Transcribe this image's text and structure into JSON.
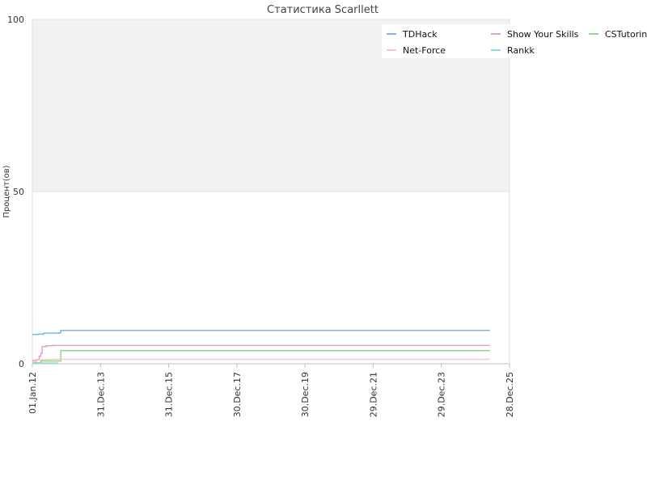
{
  "chart_data": {
    "type": "line",
    "title": "Статистика Scarllett",
    "subtitle": "",
    "xlabel": "",
    "ylabel": "Процент(ов)",
    "ylim": [
      0,
      100
    ],
    "xlim": [
      "2012-01-01",
      "2025-12-28"
    ],
    "x_tick_labels": [
      "01.Jan.12",
      "31.Dec.13",
      "31.Dec.15",
      "30.Dec.17",
      "30.Dec.19",
      "29.Dec.21",
      "29.Dec.23",
      "28.Dec.25"
    ],
    "y_tick_labels": [
      "0",
      "50",
      "100"
    ],
    "y_ticks": [
      0,
      50,
      100
    ],
    "grid": true,
    "band": {
      "from": 50,
      "to": 100,
      "color": "#f2f2f2"
    },
    "legend_position": "top-right",
    "series": [
      {
        "name": "TDHack",
        "color": "#7cb5ec",
        "points": [
          [
            "2012-01-01",
            8.5
          ],
          [
            "2012-03-01",
            8.6
          ],
          [
            "2012-05-01",
            8.9
          ],
          [
            "2012-08-01",
            8.9
          ],
          [
            "2012-10-15",
            9.0
          ],
          [
            "2012-11-01",
            9.7
          ],
          [
            "2025-06-01",
            9.7
          ]
        ]
      },
      {
        "name": "Show Your Skills",
        "color": "#e5a0c9",
        "points": [
          [
            "2012-01-01",
            0.8
          ],
          [
            "2012-02-15",
            1.2
          ],
          [
            "2012-03-15",
            2.2
          ],
          [
            "2012-04-01",
            3.0
          ],
          [
            "2012-04-15",
            5.0
          ],
          [
            "2012-06-01",
            5.2
          ],
          [
            "2012-08-01",
            5.3
          ],
          [
            "2025-06-01",
            5.3
          ]
        ]
      },
      {
        "name": "CSTutoringCenter",
        "color": "#90d890",
        "points": [
          [
            "2012-01-01",
            0.3
          ],
          [
            "2012-03-15",
            0.3
          ],
          [
            "2012-04-01",
            0.8
          ],
          [
            "2012-10-15",
            0.8
          ],
          [
            "2012-11-01",
            3.8
          ],
          [
            "2025-06-01",
            3.8
          ]
        ]
      },
      {
        "name": "Net-Force",
        "color": "#f6c6d0",
        "points": [
          [
            "2012-01-01",
            1.1
          ],
          [
            "2012-04-15",
            1.2
          ],
          [
            "2012-08-01",
            1.3
          ],
          [
            "2025-06-01",
            1.3
          ]
        ]
      },
      {
        "name": "Rankk",
        "color": "#8ae0d6",
        "points": [
          [
            "2012-01-01",
            0.2
          ],
          [
            "2012-04-01",
            0.2
          ],
          [
            "2012-10-01",
            0.2
          ]
        ]
      }
    ]
  }
}
